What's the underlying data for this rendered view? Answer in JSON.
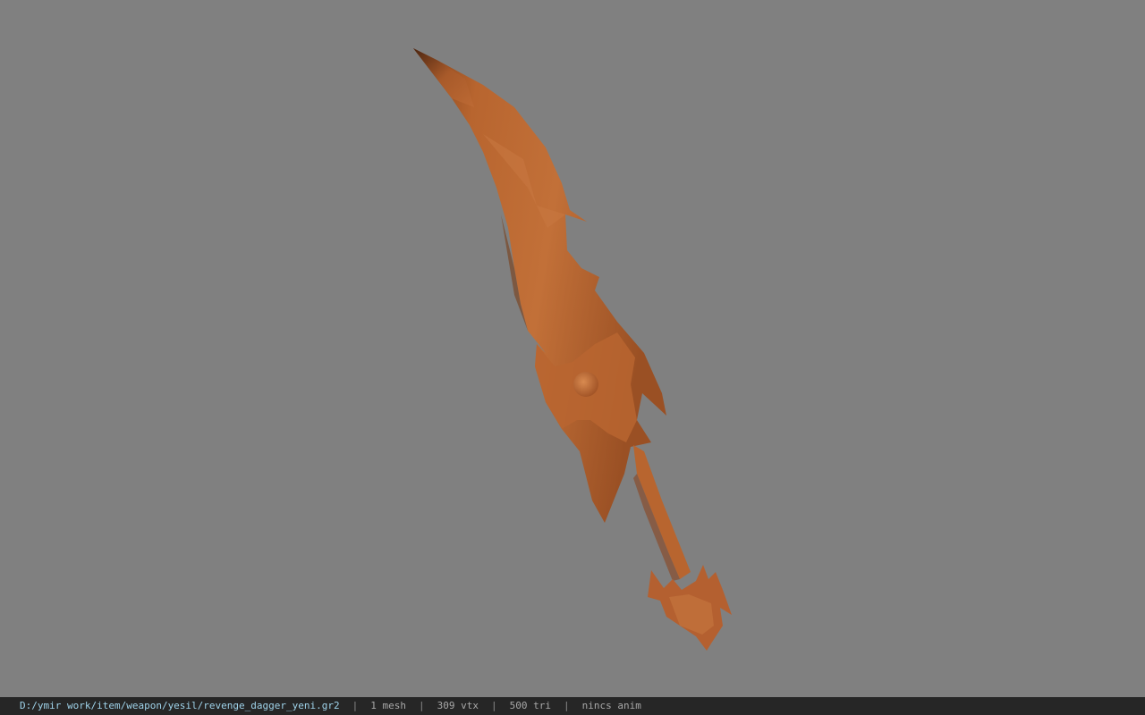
{
  "viewport": {
    "background": "#808080",
    "model_color": "#b8652f"
  },
  "status": {
    "file_path": "D:/ymir work/item/weapon/yesil/revenge_dagger_yeni.gr2",
    "separator": "|",
    "mesh": "1 mesh",
    "vertices": "309 vtx",
    "triangles": "500 tri",
    "animation": "nincs anim"
  }
}
